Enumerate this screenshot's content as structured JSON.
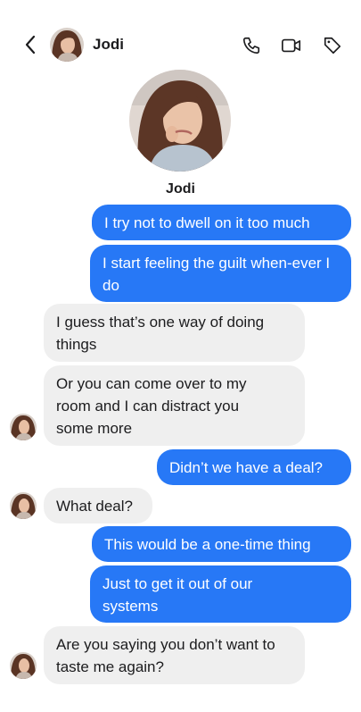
{
  "header": {
    "name": "Jodi",
    "back_icon": "chevron-left-icon",
    "call_icon": "phone-icon",
    "video_icon": "video-camera-icon",
    "tag_icon": "tag-icon"
  },
  "profile": {
    "name": "Jodi"
  },
  "colors": {
    "outgoing_bubble": "#2778f6",
    "incoming_bubble": "#efefef",
    "text_dark": "#1c1c1e"
  },
  "messages": [
    {
      "direction": "outgoing",
      "text": "I try not to dwell on it too much"
    },
    {
      "direction": "outgoing",
      "text": "I start feeling the guilt when-ever I do"
    },
    {
      "direction": "incoming",
      "text": "I guess that’s one way of doing things"
    },
    {
      "direction": "incoming",
      "text": "Or you can come over to my room and I can distract you some more"
    },
    {
      "direction": "outgoing",
      "text": "Didn’t we have a deal?"
    },
    {
      "direction": "incoming",
      "text": "What deal?"
    },
    {
      "direction": "outgoing",
      "text": "This would be a one-time thing"
    },
    {
      "direction": "outgoing",
      "text": "Just to get it out of our systems"
    },
    {
      "direction": "incoming",
      "text": "Are you saying you don’t want to taste me again?"
    }
  ]
}
